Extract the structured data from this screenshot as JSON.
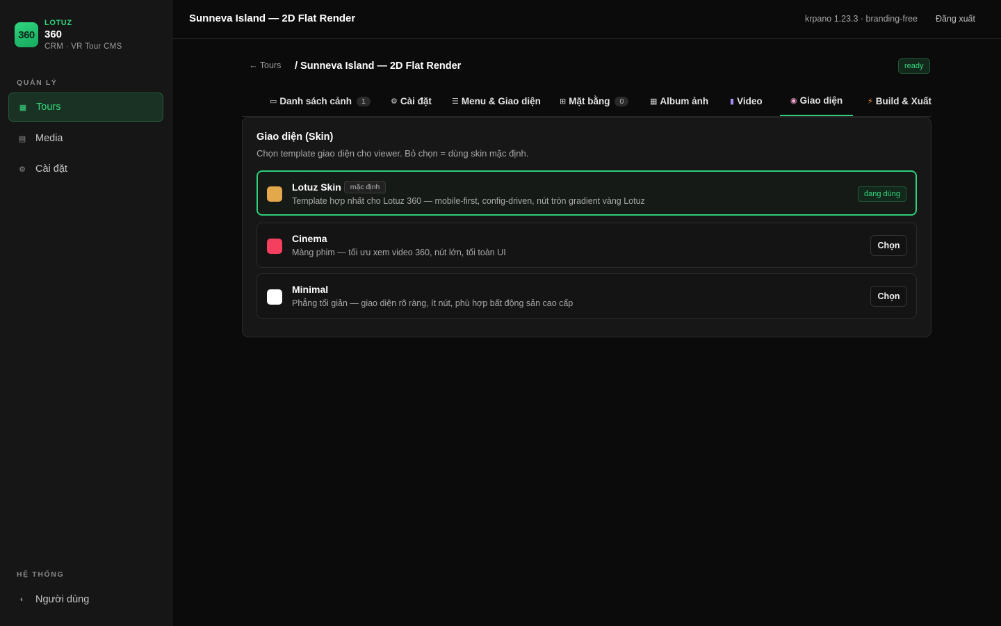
{
  "brand": {
    "logo_text": "360",
    "subtitle": "LOTUZ",
    "name": "360",
    "tagline": "CRM · VR Tour CMS"
  },
  "sidebar": {
    "section_manage": "QUẢN LÝ",
    "items": [
      {
        "label": "Tours",
        "icon": "grid-icon",
        "active": true
      },
      {
        "label": "Media",
        "icon": "list-icon",
        "active": false
      },
      {
        "label": "Cài đặt",
        "icon": "gear-icon",
        "active": false
      }
    ],
    "section_system": "HỆ THỐNG",
    "system_items": [
      {
        "label": "Người dùng",
        "icon": "half-circle-icon"
      }
    ]
  },
  "topbar": {
    "title": "Sunneva Island — 2D Flat Render",
    "version": "krpano 1.23.3 · branding-free",
    "logout": "Đăng xuất"
  },
  "breadcrumb": {
    "back": "← Tours",
    "current": "/ Sunneva Island — 2D Flat Render",
    "status": "ready"
  },
  "tabs": [
    {
      "icon": "▭",
      "label": "Danh sách cảnh",
      "count": "1"
    },
    {
      "icon": "⚙",
      "label": "Cài đặt"
    },
    {
      "icon": "☰",
      "label": "Menu & Giao diện"
    },
    {
      "icon": "⊞",
      "label": "Mặt bằng",
      "count": "0"
    },
    {
      "icon": "▦",
      "label": "Album ảnh"
    },
    {
      "icon": "▮",
      "label": "Video"
    },
    {
      "icon": "◉",
      "label": "Giao diện",
      "active": true
    },
    {
      "icon": "⚡",
      "label": "Build & Xuất"
    }
  ],
  "skin_panel": {
    "title": "Giao diện (Skin)",
    "description": "Chọn template giao diện cho viewer. Bỏ chọn = dùng skin mặc định.",
    "skins": [
      {
        "name": "Lotuz Skin",
        "tag": "mặc định",
        "description": "Template hợp nhất cho Lotuz 360 — mobile-first, config-driven, nút tròn gradient vàng Lotuz",
        "color": "#e3a84a",
        "status": "đang dùng",
        "active": true
      },
      {
        "name": "Cinema",
        "description": "Màng phim — tối ưu xem video 360, nút lớn, tối toàn UI",
        "color": "#f43f5e",
        "action": "Chọn"
      },
      {
        "name": "Minimal",
        "description": "Phẳng tối giản — giao diện rõ ràng, ít nút, phù hợp bất động sản cao cấp",
        "color": "#ffffff",
        "action": "Chọn"
      }
    ]
  },
  "colors": {
    "accent": "#2fcf7b",
    "background": "#0b0b0b",
    "sidebar": "#161616"
  }
}
